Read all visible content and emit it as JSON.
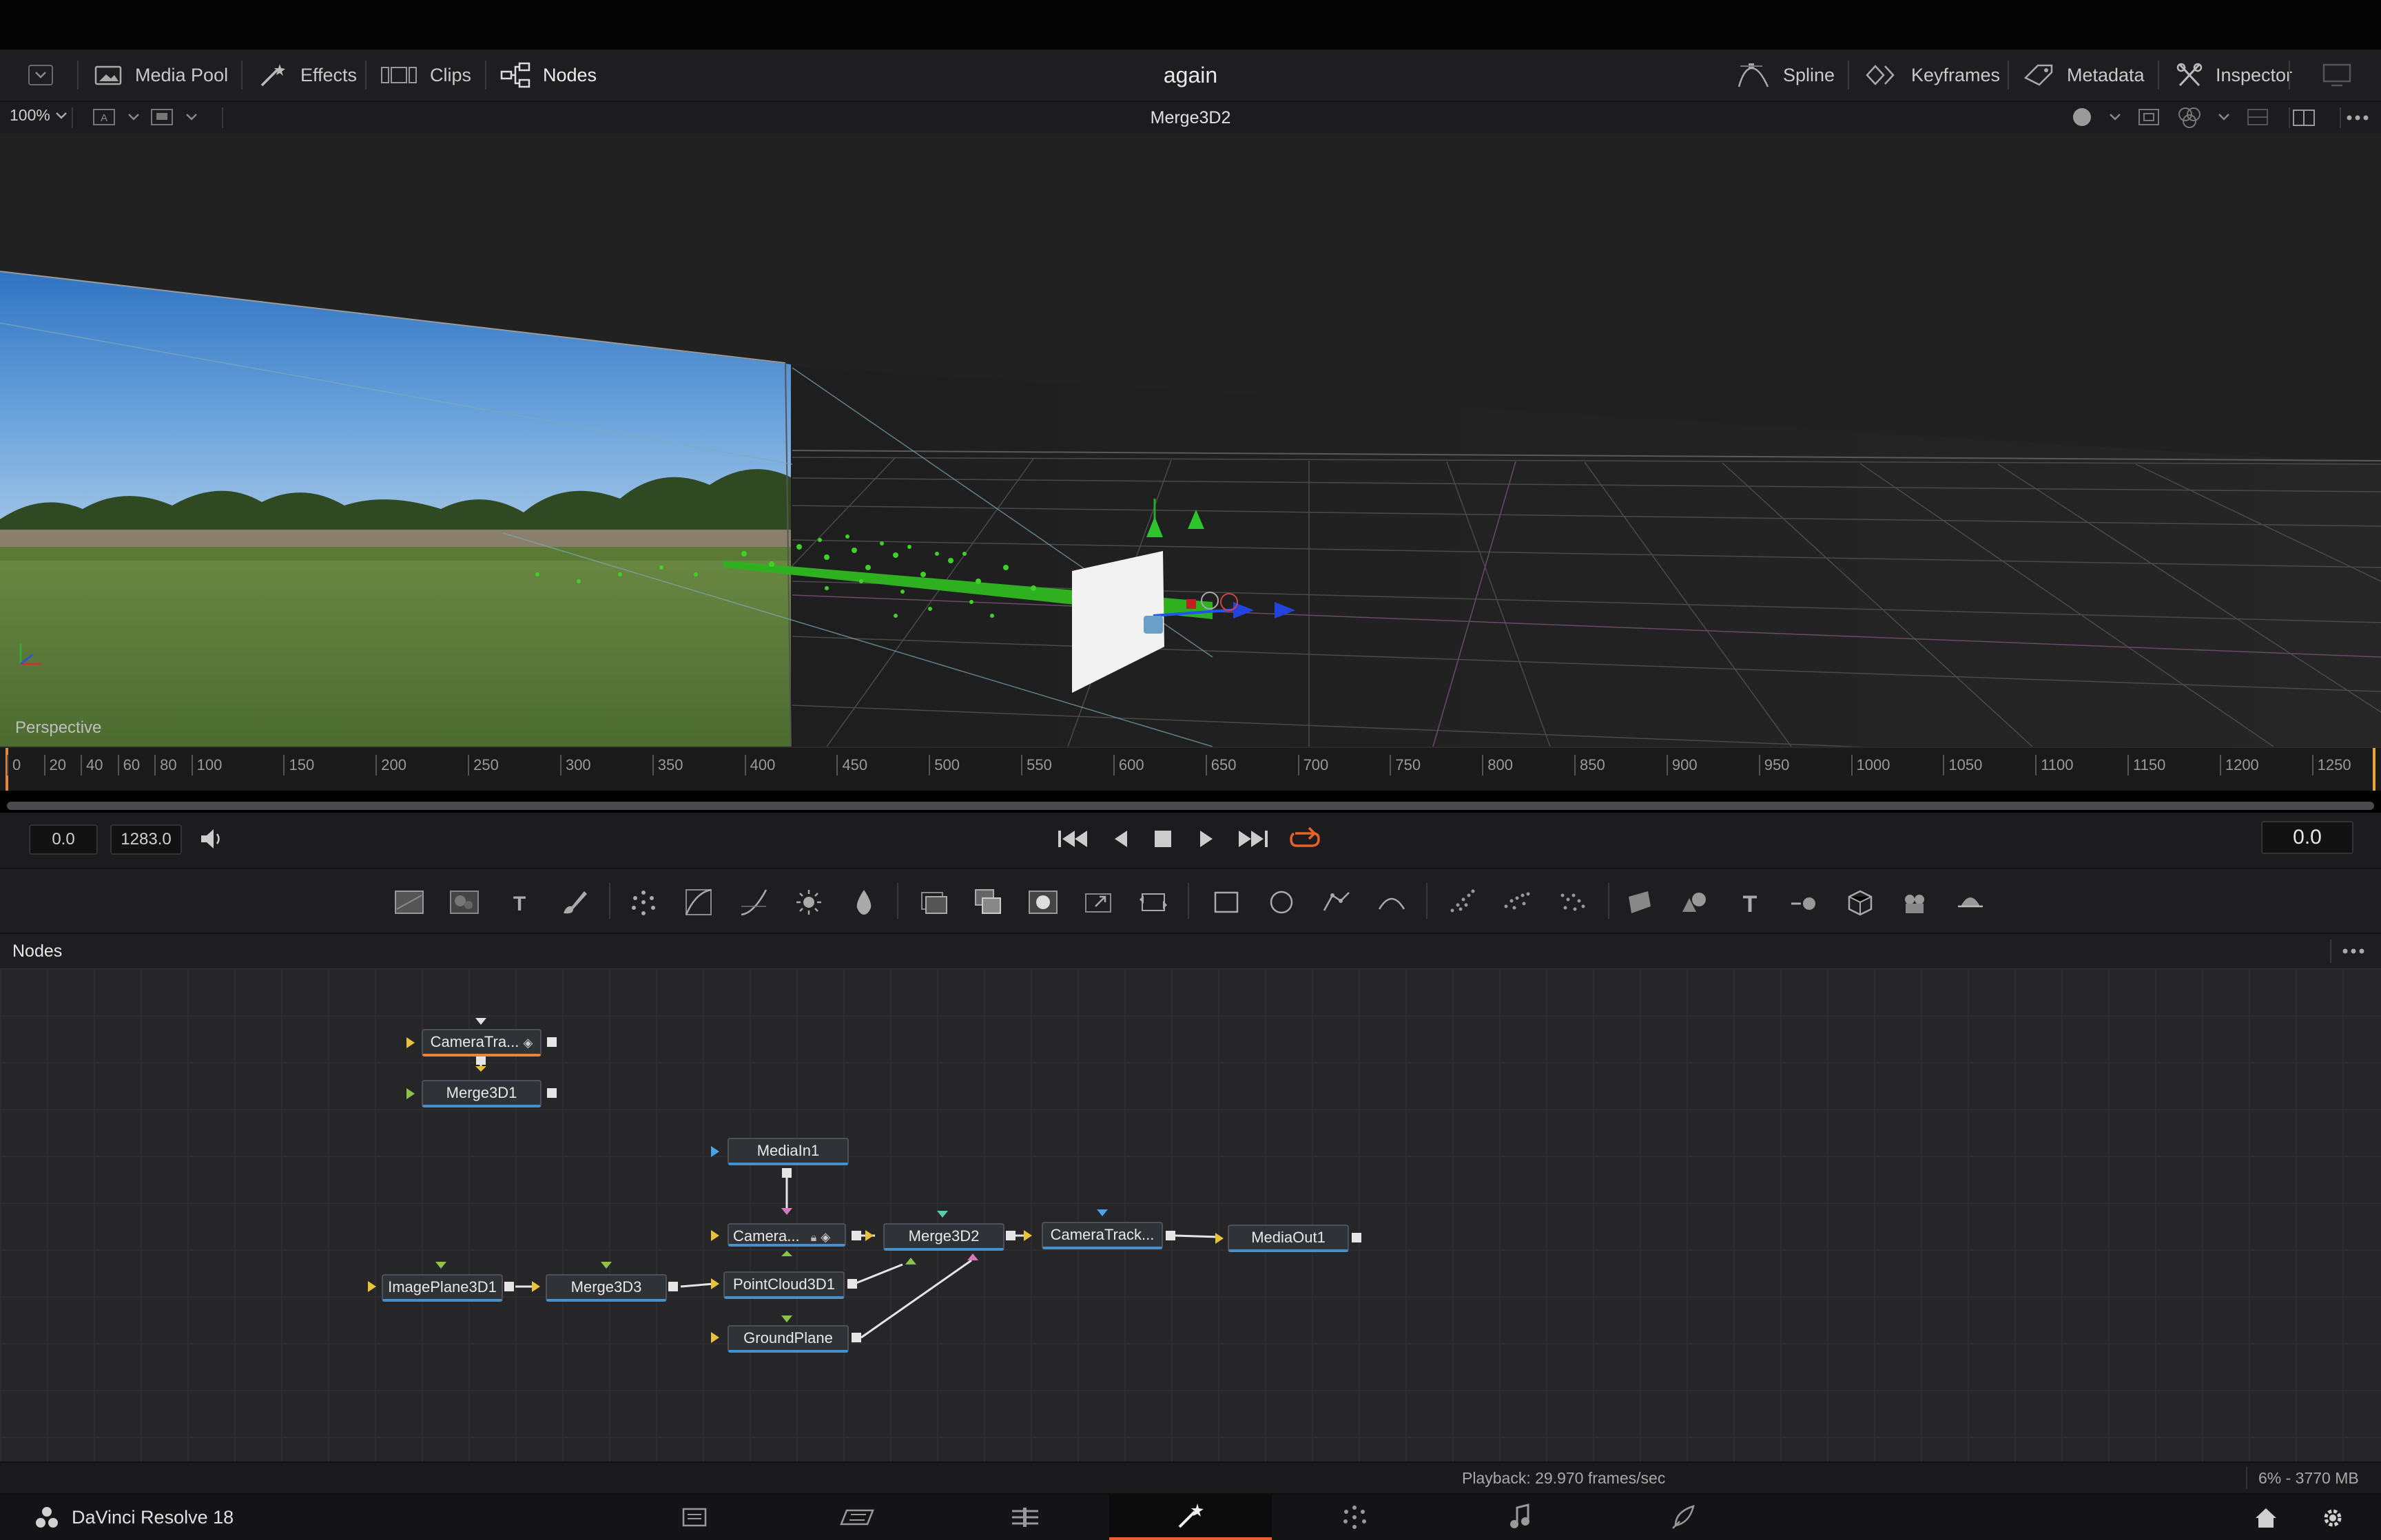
{
  "toolbar": {
    "left": [
      {
        "label": "Media Pool",
        "icon": "media-pool-icon"
      },
      {
        "label": "Effects",
        "icon": "effects-icon"
      },
      {
        "label": "Clips",
        "icon": "clips-icon"
      },
      {
        "label": "Nodes",
        "icon": "nodes-icon"
      }
    ],
    "project_title": "again",
    "right": [
      {
        "label": "Spline",
        "icon": "spline-icon"
      },
      {
        "label": "Keyframes",
        "icon": "keyframes-icon"
      },
      {
        "label": "Metadata",
        "icon": "metadata-icon"
      },
      {
        "label": "Inspector",
        "icon": "inspector-icon"
      }
    ]
  },
  "viewer": {
    "zoom": "100%",
    "node_name": "Merge3D2",
    "view_label": "Perspective"
  },
  "ruler": {
    "ticks": [
      "0",
      "20",
      "40",
      "60",
      "80",
      "100",
      "150",
      "200",
      "250",
      "300",
      "350",
      "400",
      "450",
      "500",
      "550",
      "600",
      "650",
      "700",
      "750",
      "800",
      "850",
      "900",
      "950",
      "1000",
      "1050",
      "1100",
      "1150",
      "1200",
      "1250"
    ]
  },
  "transport": {
    "start": "0.0",
    "end": "1283.0",
    "current": "0.0"
  },
  "nodes_panel": {
    "title": "Nodes",
    "nodes": {
      "cameratracker_a": "CameraTra...",
      "merge3d1": "Merge3D1",
      "mediain1": "MediaIn1",
      "camera": "Camera...",
      "merge3d2": "Merge3D2",
      "cameratracker_b": "CameraTrack...",
      "mediaout1": "MediaOut1",
      "imageplane3d1": "ImagePlane3D1",
      "merge3d3": "Merge3D3",
      "pointcloud3d1": "PointCloud3D1",
      "groundplane": "GroundPlane"
    }
  },
  "status": {
    "playback": "Playback: 29.970 frames/sec",
    "memory": "6% - 3770 MB"
  },
  "app": {
    "name": "DaVinci Resolve 18",
    "pages": [
      "media-page-icon",
      "cut-page-icon",
      "edit-page-icon",
      "fusion-page-icon",
      "color-page-icon",
      "fairlight-page-icon",
      "deliver-page-icon"
    ],
    "active_page": "fusion-page-icon"
  },
  "colors": {
    "accent_orange": "#e8602c",
    "node_link_blue": "#4a90c8",
    "pointcloud_green": "#3fd12a"
  }
}
